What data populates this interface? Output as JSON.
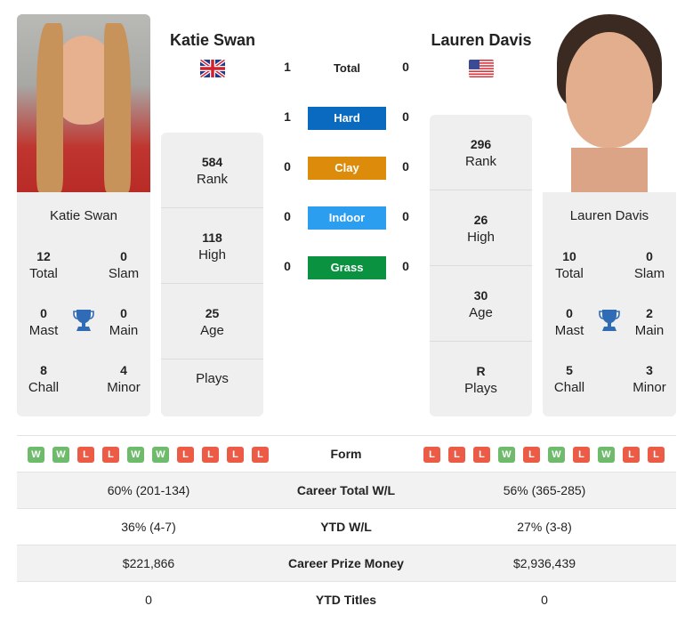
{
  "player_left": {
    "name": "Katie Swan",
    "country_flag": "uk-flag",
    "titles": {
      "total": "12",
      "slam": "0",
      "mast": "0",
      "main": "0",
      "chall": "8",
      "minor": "4"
    },
    "rank": "584",
    "high": "118",
    "age": "25",
    "plays": ""
  },
  "player_right": {
    "name": "Lauren Davis",
    "country_flag": "us-flag",
    "titles": {
      "total": "10",
      "slam": "0",
      "mast": "0",
      "main": "2",
      "chall": "5",
      "minor": "3"
    },
    "rank": "296",
    "high": "26",
    "age": "30",
    "plays": "R"
  },
  "labels": {
    "total": "Total",
    "slam": "Slam",
    "mast": "Mast",
    "main": "Main",
    "chall": "Chall",
    "minor": "Minor",
    "rank": "Rank",
    "high": "High",
    "age": "Age",
    "plays": "Plays"
  },
  "h2h": {
    "total": {
      "label": "Total",
      "left": "1",
      "right": "0"
    },
    "surfaces": [
      {
        "label": "Hard",
        "left": "1",
        "right": "0",
        "color": "#0a6ac0"
      },
      {
        "label": "Clay",
        "left": "0",
        "right": "0",
        "color": "#dc8c0a"
      },
      {
        "label": "Indoor",
        "left": "0",
        "right": "0",
        "color": "#2b9ef0"
      },
      {
        "label": "Grass",
        "left": "0",
        "right": "0",
        "color": "#0a9240"
      }
    ]
  },
  "form": {
    "label": "Form",
    "left": [
      "W",
      "W",
      "L",
      "L",
      "W",
      "W",
      "L",
      "L",
      "L",
      "L"
    ],
    "right": [
      "L",
      "L",
      "L",
      "W",
      "L",
      "W",
      "L",
      "W",
      "L",
      "L"
    ],
    "win_color": "#6dbb6b",
    "loss_color": "#ec5b45"
  },
  "comparison": [
    {
      "label": "Career Total W/L",
      "left": "60% (201-134)",
      "right": "56% (365-285)"
    },
    {
      "label": "YTD W/L",
      "left": "36% (4-7)",
      "right": "27% (3-8)"
    },
    {
      "label": "Career Prize Money",
      "left": "$221,866",
      "right": "$2,936,439"
    },
    {
      "label": "YTD Titles",
      "left": "0",
      "right": "0"
    }
  ]
}
